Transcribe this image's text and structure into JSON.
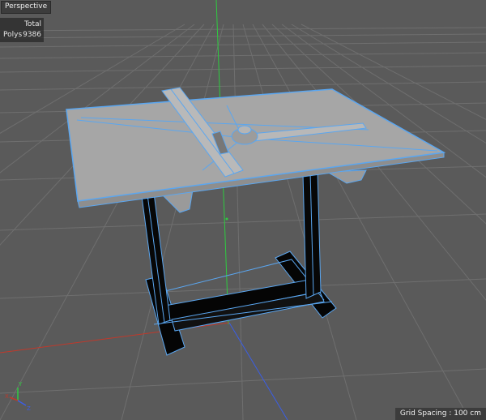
{
  "viewport": {
    "view_name": "Perspective",
    "stats": {
      "total_label": "Total",
      "polys_label": "Polys",
      "polys_value": "9386"
    },
    "grid_spacing": "Grid Spacing : 100 cm",
    "axis_gizmo": {
      "y": "Y",
      "x": "X",
      "z": "Z"
    }
  },
  "colors": {
    "background": "#5a5a5a",
    "grid_line": "#6e6e6e",
    "wire": "#5aa6f0",
    "surface": "#a3a3a3",
    "axis_x": "#c0392b",
    "axis_y": "#2ecc40",
    "axis_z": "#3b5ee6"
  },
  "icons": [
    "axis-gizmo-icon"
  ]
}
